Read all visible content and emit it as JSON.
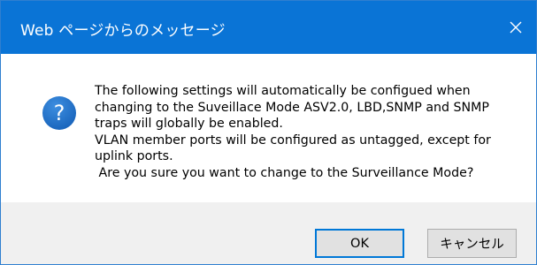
{
  "dialog": {
    "title": "Web ページからのメッセージ",
    "close_icon": "close-icon",
    "question_icon": "question-icon",
    "message_lines": [
      "The following settings will automatically be configued when",
      "changing to the Suveillace Mode ASV2.0, LBD,SNMP and SNMP",
      "traps will globally be enabled.",
      "VLAN member ports will be configured as untagged, except for",
      "uplink ports.",
      " Are you sure you want to change to the Surveillance Mode?"
    ],
    "ok_label": "OK",
    "cancel_label": "キャンセル"
  },
  "colors": {
    "titlebar": "#0a74d6",
    "icon_blue": "#1a6fc4",
    "footer": "#f0f0f0",
    "focus_border": "#0078d7"
  }
}
